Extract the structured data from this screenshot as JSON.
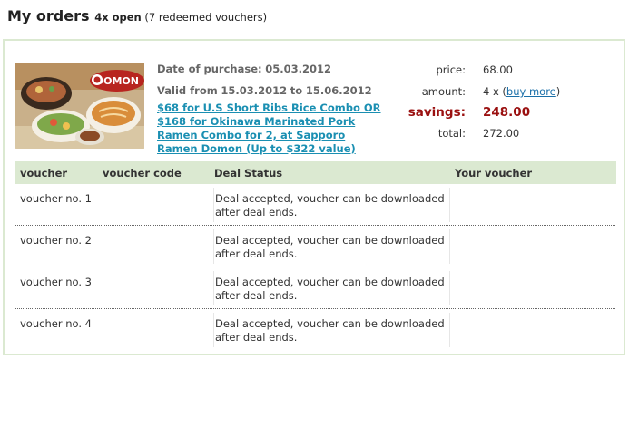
{
  "header": {
    "title": "My orders",
    "open_count": "4x open",
    "redeemed": "(7 redeemed vouchers)"
  },
  "deal": {
    "image_alt": "deal-food-photo",
    "brand": "DOMON",
    "purchase_label": "Date of purchase:",
    "purchase_date": "05.03.2012",
    "valid_prefix": "Valid from",
    "valid_from": "15.03.2012",
    "valid_to_word": "to",
    "valid_to": "15.06.2012",
    "title": "$68 for U.S Short Ribs Rice Combo OR $168 for Okinawa Marinated Pork Ramen Combo for 2, at Sapporo Ramen Domon (Up to $322 value)"
  },
  "summary": {
    "price_label": "price:",
    "price": "68.00",
    "amount_label": "amount:",
    "amount": "4 x (",
    "buy_more": "buy more",
    "amount_close": ")",
    "savings_label": "savings:",
    "savings": "248.00",
    "total_label": "total:",
    "total": "272.00"
  },
  "table": {
    "headers": [
      "voucher",
      "voucher code",
      "Deal Status",
      "Your voucher"
    ],
    "rows": [
      {
        "voucher": "voucher no. 1",
        "code": "",
        "status": "Deal accepted, voucher can be downloaded after deal ends.",
        "download": ""
      },
      {
        "voucher": "voucher no. 2",
        "code": "",
        "status": "Deal accepted, voucher can be downloaded after deal ends.",
        "download": ""
      },
      {
        "voucher": "voucher no. 3",
        "code": "",
        "status": "Deal accepted, voucher can be downloaded after deal ends.",
        "download": ""
      },
      {
        "voucher": "voucher no. 4",
        "code": "",
        "status": "Deal accepted, voucher can be downloaded after deal ends.",
        "download": ""
      }
    ]
  },
  "colors": {
    "accent_green": "#dbe9d1",
    "link_blue": "#1a8fb2",
    "savings_red": "#9a1010"
  }
}
